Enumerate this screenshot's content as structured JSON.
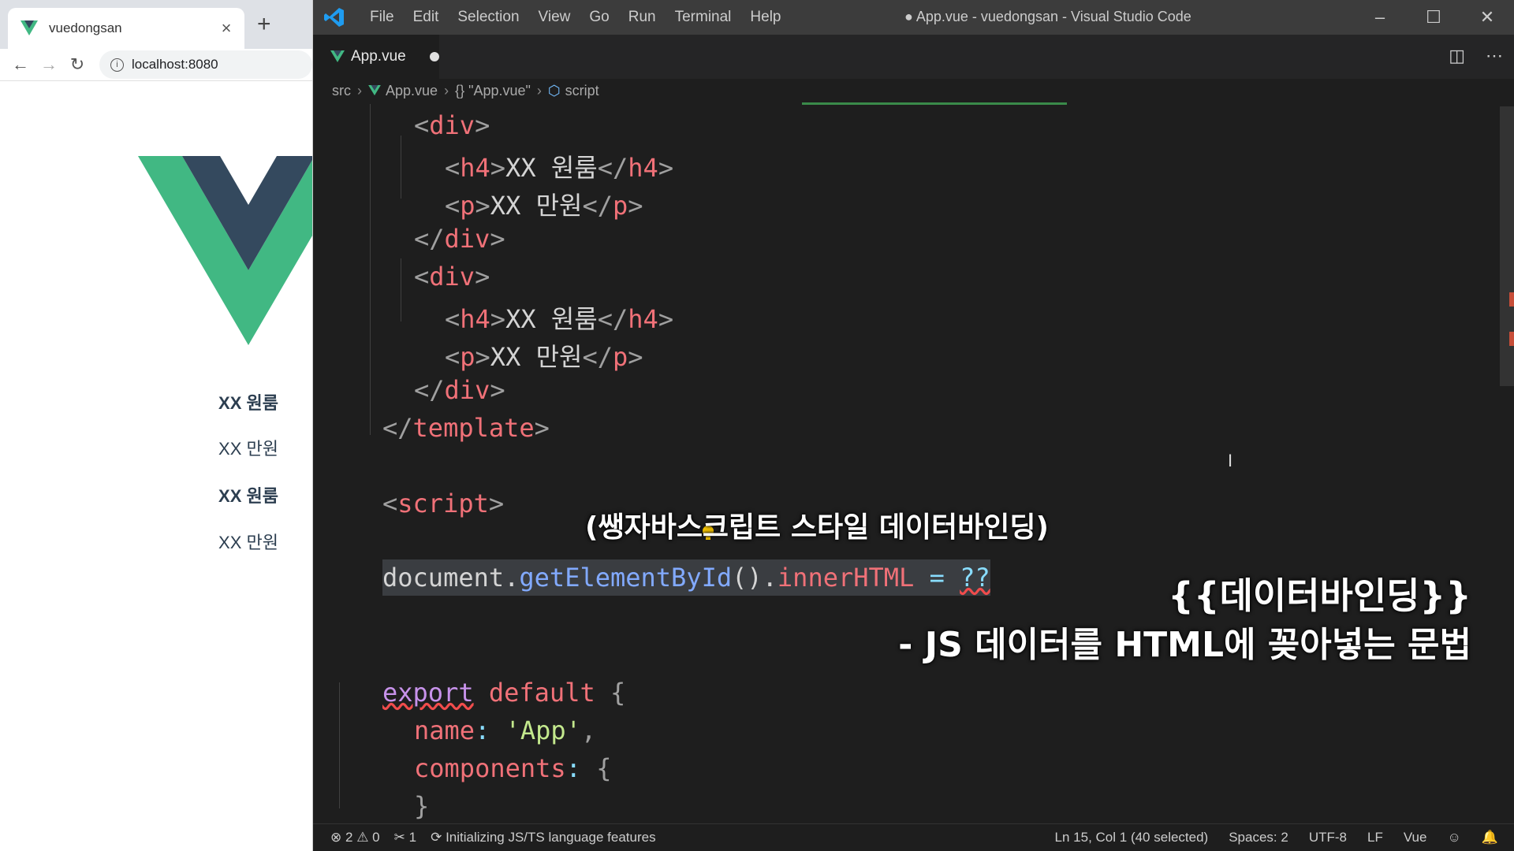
{
  "browser": {
    "tab_title": "vuedongsan",
    "close_glyph": "×",
    "new_tab_glyph": "+",
    "url": "localhost:8080",
    "content": {
      "items": [
        {
          "title": "XX 원룸",
          "price": "XX 만원"
        },
        {
          "title": "XX 원룸",
          "price": "XX 만원"
        }
      ]
    }
  },
  "vscode": {
    "menu": [
      "File",
      "Edit",
      "Selection",
      "View",
      "Go",
      "Run",
      "Terminal",
      "Help"
    ],
    "window_title": "● App.vue - vuedongsan - Visual Studio Code",
    "tab": {
      "name": "App.vue"
    },
    "breadcrumbs": {
      "folder": "src",
      "file": "App.vue",
      "object": "{} \"App.vue\"",
      "symbol": "script"
    },
    "code": {
      "line1": "<div>",
      "line2_tag_open": "<h4>",
      "line2_text": "XX 원룸",
      "line2_tag_close": "</h4>",
      "line3_tag_open": "<p>",
      "line3_text": "XX 만원",
      "line3_tag_close": "</p>",
      "line4": "</div>",
      "template_close": "</template>",
      "script_open": "<script>",
      "doc_obj": "document",
      "doc_fn": "getElementById",
      "doc_parens": "()",
      "doc_prop": "innerHTML",
      "doc_eq": " = ",
      "doc_q": "??",
      "export_kw": "export",
      "export_default": "default",
      "brace_open": "{",
      "name_key": "name",
      "name_val": "'App'",
      "components_key": "components",
      "brace_close": "}"
    },
    "overlays": {
      "caption1": "(쌩자바스크립트 스타일 데이터바인딩)",
      "caption2": "{{데이터바인딩}}",
      "caption3": "- JS 데이터를 HTML에 꽂아넣는 문법"
    },
    "status": {
      "errors": "2",
      "warnings": "0",
      "tools": "1",
      "message": "Initializing JS/TS language features",
      "position": "Ln 15, Col 1 (40 selected)",
      "spaces": "Spaces: 2",
      "encoding": "UTF-8",
      "eol": "LF",
      "language": "Vue"
    }
  }
}
